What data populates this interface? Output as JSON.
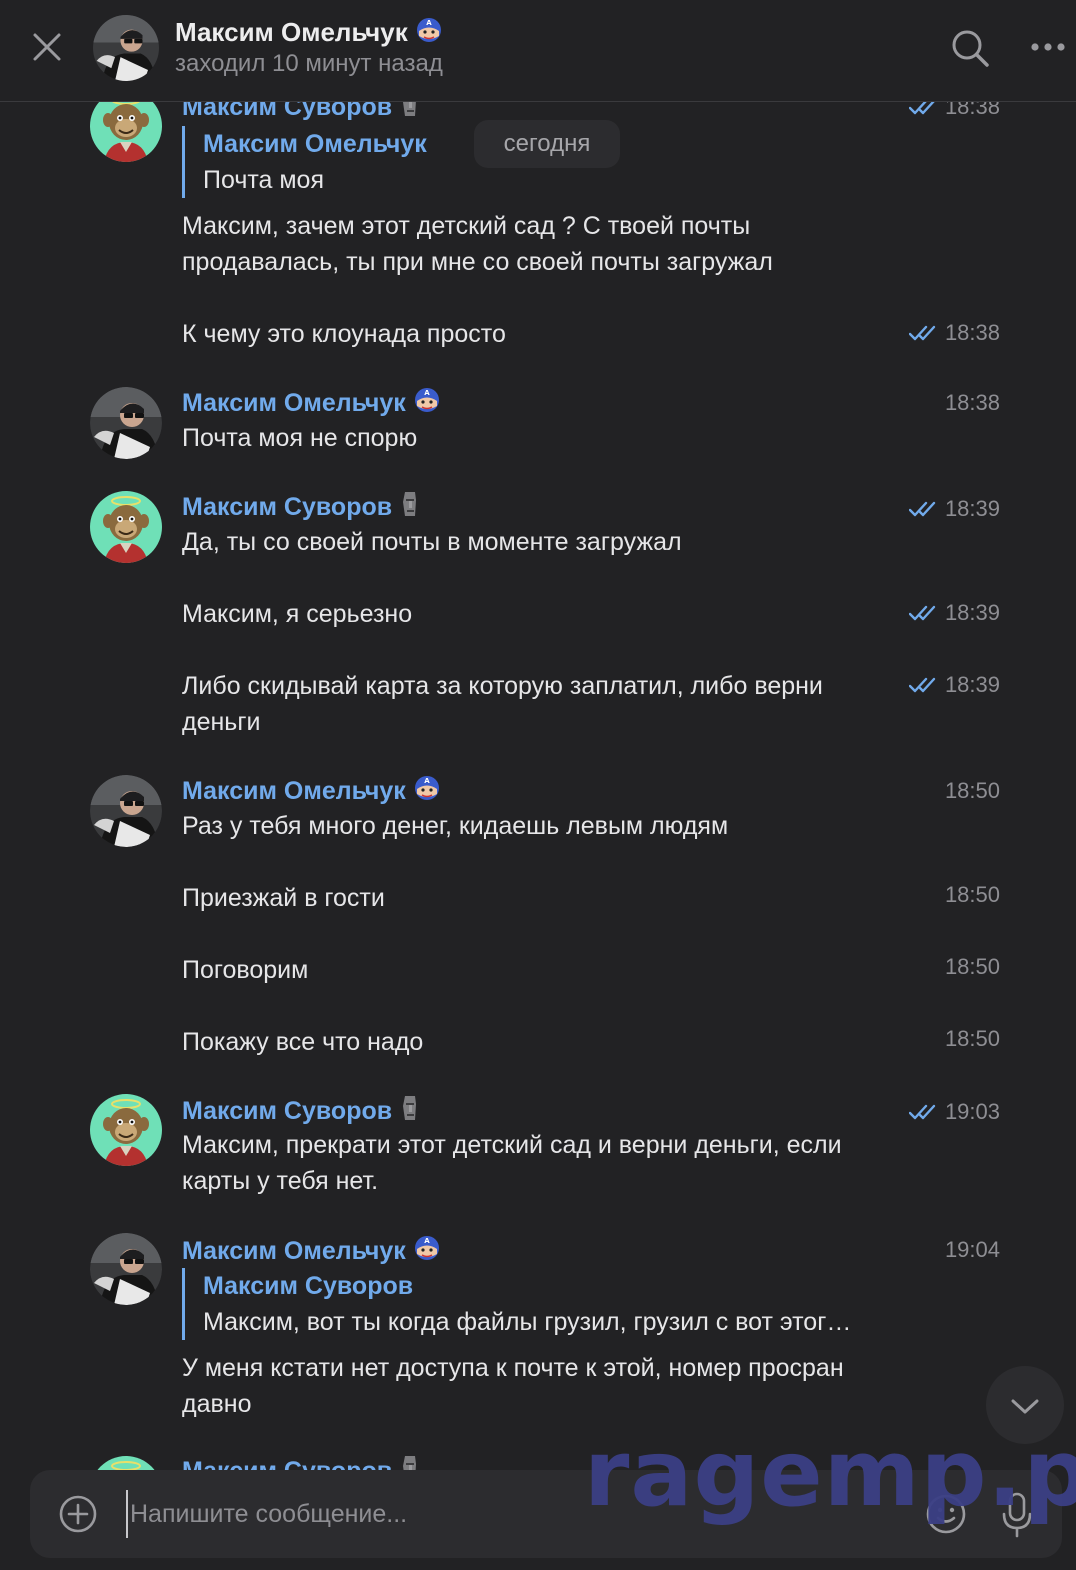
{
  "header": {
    "name": "Максим Омельчук",
    "status": "заходил 10 минут назад"
  },
  "date_separator": "сегодня",
  "messages": [
    {
      "author": "Максим Суворов",
      "time": "18:38",
      "reply": {
        "author": "Максим Омельчук",
        "text": "Почта моя"
      },
      "text": "Максим, зачем этот детский сад ? С твоей почты продавалась, ты при мне со своей почты загружал"
    },
    {
      "time": "18:38",
      "text": "К чему это клоунада просто"
    },
    {
      "author": "Максим Омельчук",
      "time": "18:38",
      "text": "Почта моя не спорю"
    },
    {
      "author": "Максим Суворов",
      "time": "18:39",
      "text": "Да, ты со своей почты в моменте загружал"
    },
    {
      "time": "18:39",
      "text": "Максим, я серьезно"
    },
    {
      "time": "18:39",
      "text": "Либо скидывай карта за которую заплатил, либо верни деньги"
    },
    {
      "author": "Максим Омельчук",
      "time": "18:50",
      "text": "Раз у тебя много денег, кидаешь левым людям"
    },
    {
      "time": "18:50",
      "text": "Приезжай в гости"
    },
    {
      "time": "18:50",
      "text": "Поговорим"
    },
    {
      "time": "18:50",
      "text": "Покажу все что надо"
    },
    {
      "author": "Максим Суворов",
      "time": "19:03",
      "text": "Максим, прекрати этот детский сад и верни деньги, если карты у тебя нет."
    },
    {
      "author": "Максим Омельчук",
      "time": "19:04",
      "reply": {
        "author": "Максим Суворов",
        "text": "Максим, вот ты когда файлы грузил, грузил с вот этог…"
      },
      "text": "У меня кстати нет доступа к почте к этой, номер просран давно"
    },
    {
      "author": "Максим Суворов",
      "time": ""
    }
  ],
  "composer": {
    "placeholder": "Напишите сообщение..."
  },
  "watermark": "ragemp.pro",
  "icons": {
    "close": "close-icon",
    "search": "search-icon",
    "more": "more-icon",
    "attach": "plus-circle-icon",
    "emoji": "smile-icon",
    "mic": "microphone-icon",
    "scroll": "chevron-down-icon",
    "read": "double-check-icon"
  },
  "colors": {
    "background": "#222224",
    "author_link": "#71aaeb",
    "check_marks": "#71aaeb",
    "watermark": "#3b3f85"
  }
}
